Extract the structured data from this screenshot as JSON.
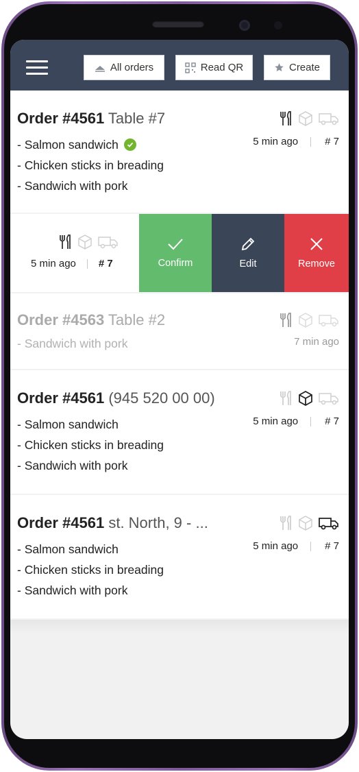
{
  "header": {
    "all_orders_label": "All orders",
    "read_qr_label": "Read QR",
    "create_label": "Create"
  },
  "orders": [
    {
      "number": "Order #4561",
      "detail": "Table #7",
      "items": [
        "- Salmon sandwich",
        "- Chicken sticks in breading",
        "- Sandwich with pork"
      ],
      "time": "5 min ago",
      "table": "# 7",
      "mode": "dine-in",
      "first_item_done": true
    },
    {
      "time": "5 min ago",
      "table": "# 7",
      "mode": "dine-in",
      "actions": {
        "confirm": "Confirm",
        "edit": "Edit",
        "remove": "Remove"
      }
    },
    {
      "number": "Order #4563",
      "detail": "Table #2",
      "items": [
        "- Sandwich with pork"
      ],
      "time": "7 min ago",
      "mode": "dine-in",
      "state": "faded"
    },
    {
      "number": "Order #4561",
      "detail": "(945 520 00 00)",
      "items": [
        "- Salmon sandwich",
        "- Chicken sticks in breading",
        "- Sandwich with pork"
      ],
      "time": "5 min ago",
      "table": "# 7",
      "mode": "takeaway"
    },
    {
      "number": "Order #4561",
      "detail": "st. North, 9 - ...",
      "items": [
        "- Salmon sandwich",
        "- Chicken sticks in breading",
        "- Sandwich with pork"
      ],
      "time": "5 min ago",
      "table": "# 7",
      "mode": "delivery"
    }
  ],
  "icons": {
    "menu": "hamburger-icon",
    "all_orders": "stack-icon",
    "read_qr": "qr-icon",
    "create": "star-icon",
    "dine_in": "cutlery-icon",
    "takeaway": "package-icon",
    "delivery": "truck-icon",
    "confirm": "check-icon",
    "edit": "pencil-icon",
    "remove": "close-icon",
    "done": "done-badge-icon"
  },
  "colors": {
    "header_bg": "#3c465b",
    "confirm": "#63bb6e",
    "edit": "#3b4558",
    "remove": "#e03f47",
    "done_badge": "#73b52f"
  }
}
